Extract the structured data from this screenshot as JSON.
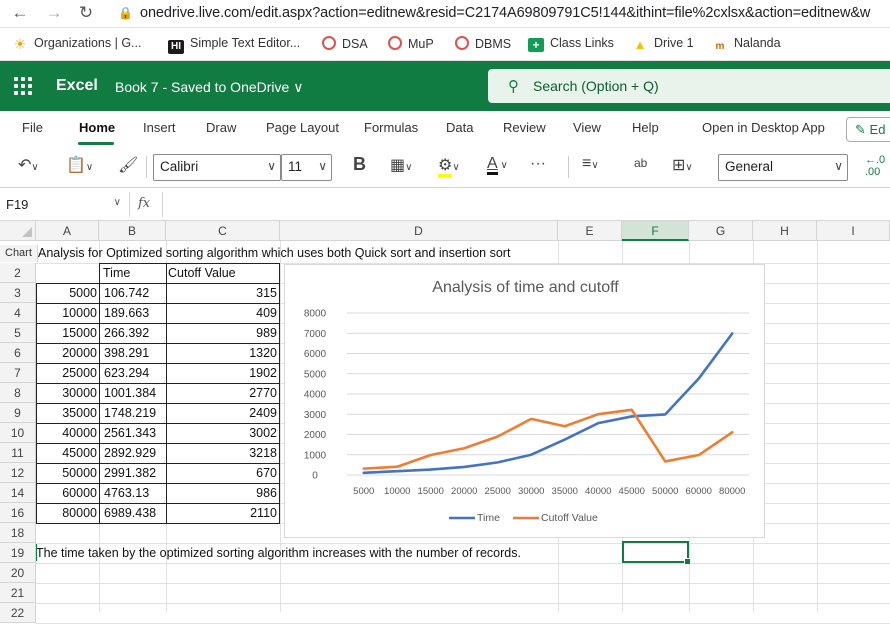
{
  "browser": {
    "url": "onedrive.live.com/edit.aspx?action=editnew&resid=C2174A69809791C5!144&ithint=file%2cxlsx&action=editnew&w",
    "bookmarks": [
      {
        "label": "Organizations | G...",
        "icon": "sun-icon"
      },
      {
        "label": "Simple Text Editor...",
        "icon": "hi-icon"
      },
      {
        "label": "DSA",
        "icon": "circle-logo-icon"
      },
      {
        "label": "MuP",
        "icon": "circle-logo-icon"
      },
      {
        "label": "DBMS",
        "icon": "circle-logo-icon"
      },
      {
        "label": "Class Links",
        "icon": "plus-square-icon"
      },
      {
        "label": "Drive 1",
        "icon": "drive-icon"
      },
      {
        "label": "Nalanda",
        "icon": "nalanda-icon"
      }
    ]
  },
  "app": {
    "name": "Excel",
    "doc_title": "Book 7  -  Saved to OneDrive ∨",
    "search_placeholder": "Search (Option + Q)"
  },
  "menu": {
    "items": [
      "File",
      "Home",
      "Insert",
      "Draw",
      "Page Layout",
      "Formulas",
      "Data",
      "Review",
      "View",
      "Help",
      "Open in Desktop App"
    ],
    "active": "Home",
    "edit_label": "Ed"
  },
  "toolbar": {
    "font_name": "Calibri",
    "font_size": "11",
    "number_format": "General",
    "bold_label": "B",
    "more_label": "···"
  },
  "formula_bar": {
    "name_box": "F19",
    "fx_label": "fx",
    "formula": ""
  },
  "sheet": {
    "columns": [
      "A",
      "B",
      "C",
      "D",
      "E",
      "F",
      "G",
      "H",
      "I"
    ],
    "selected_column": "F",
    "rows": [
      "Chart",
      "2",
      "3",
      "4",
      "5",
      "6",
      "7",
      "8",
      "9",
      "10",
      "11",
      "12",
      "14",
      "16",
      "18",
      "19",
      "20",
      "21",
      "22"
    ],
    "title_text": "Analysis for Optimized sorting algorithm which uses both Quick sort and insertion sort",
    "table_headers": [
      "",
      "Time",
      "Cutoff Value"
    ],
    "table_rows": [
      [
        "5000",
        "106.742",
        "315"
      ],
      [
        "10000",
        "189.663",
        "409"
      ],
      [
        "15000",
        "266.392",
        "989"
      ],
      [
        "20000",
        "398.291",
        "1320"
      ],
      [
        "25000",
        "623.294",
        "1902"
      ],
      [
        "30000",
        "1001.384",
        "2770"
      ],
      [
        "35000",
        "1748.219",
        "2409"
      ],
      [
        "40000",
        "2561.343",
        "3002"
      ],
      [
        "45000",
        "2892.929",
        "3218"
      ],
      [
        "50000",
        "2991.382",
        "670"
      ],
      [
        "60000",
        "4763.13",
        "986"
      ],
      [
        "80000",
        "6989.438",
        "2110"
      ]
    ],
    "conclusion_text": "The time taken by the optimized sorting algorithm increases with the number of records."
  },
  "chart_data": {
    "type": "line",
    "title": "Analysis of time and cutoff",
    "categories": [
      "5000",
      "10000",
      "15000",
      "20000",
      "25000",
      "30000",
      "35000",
      "40000",
      "45000",
      "50000",
      "60000",
      "80000"
    ],
    "series": [
      {
        "name": "Time",
        "color": "#4472c4",
        "values": [
          106.742,
          189.663,
          266.392,
          398.291,
          623.294,
          1001.384,
          1748.219,
          2561.343,
          2892.929,
          2991.382,
          4763.13,
          6989.438
        ]
      },
      {
        "name": "Cutoff Value",
        "color": "#ed7d31",
        "values": [
          315,
          409,
          989,
          1320,
          1902,
          2770,
          2409,
          3002,
          3218,
          670,
          986,
          2110
        ]
      }
    ],
    "yticks": [
      "0",
      "1000",
      "2000",
      "3000",
      "4000",
      "5000",
      "6000",
      "7000",
      "8000"
    ],
    "ylim": [
      0,
      8000
    ],
    "grid": true,
    "legend": "bottom"
  },
  "colors": {
    "excel_green": "#107c41"
  }
}
